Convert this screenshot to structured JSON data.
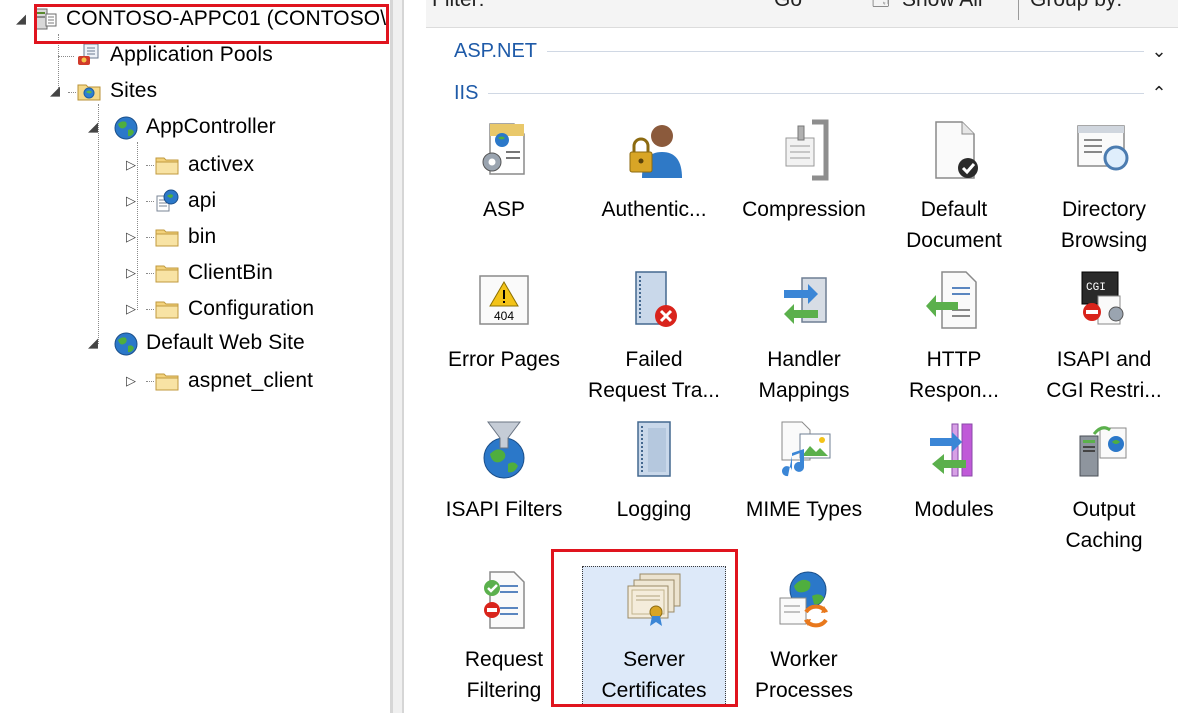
{
  "tree": {
    "nodes": [
      {
        "label": "CONTOSO-APPC01 (CONTOSO\\",
        "icon": "server-icon",
        "level": 0
      },
      {
        "label": "Application Pools",
        "icon": "app-pool-icon",
        "level": 1
      },
      {
        "label": "Sites",
        "icon": "sites-folder-icon",
        "level": 1
      },
      {
        "label": "AppController",
        "icon": "globe-icon",
        "level": 2
      },
      {
        "label": "activex",
        "icon": "folder-icon",
        "level": 3
      },
      {
        "label": "api",
        "icon": "web-app-icon",
        "level": 3
      },
      {
        "label": "bin",
        "icon": "folder-icon",
        "level": 3
      },
      {
        "label": "ClientBin",
        "icon": "folder-icon",
        "level": 3
      },
      {
        "label": "Configuration",
        "icon": "folder-icon",
        "level": 3
      },
      {
        "label": "Default Web Site",
        "icon": "globe-icon",
        "level": 2
      },
      {
        "label": "aspnet_client",
        "icon": "folder-icon",
        "level": 3
      }
    ]
  },
  "toolbar": {
    "filter_label": "Filter:",
    "go_label": "Go",
    "show_all_label": "Show All",
    "group_by_label": "Group by:"
  },
  "groups": {
    "aspnet": {
      "name": "ASP.NET",
      "chevron": "⌄"
    },
    "iis": {
      "name": "IIS",
      "chevron": "⌃"
    }
  },
  "features": [
    {
      "label": "ASP",
      "icon": "asp-icon"
    },
    {
      "label": "Authentic...",
      "icon": "authentication-icon"
    },
    {
      "label": "Compression",
      "icon": "compression-icon"
    },
    {
      "label": "Default\nDocument",
      "icon": "default-document-icon"
    },
    {
      "label": "Directory\nBrowsing",
      "icon": "directory-browsing-icon"
    },
    {
      "label": "Error Pages",
      "icon": "error-pages-icon"
    },
    {
      "label": "Failed\nRequest Tra...",
      "icon": "failed-request-tracing-icon"
    },
    {
      "label": "Handler\nMappings",
      "icon": "handler-mappings-icon"
    },
    {
      "label": "HTTP\nRespon...",
      "icon": "http-response-headers-icon"
    },
    {
      "label": "ISAPI and\nCGI Restri...",
      "icon": "isapi-cgi-restrictions-icon"
    },
    {
      "label": "ISAPI Filters",
      "icon": "isapi-filters-icon"
    },
    {
      "label": "Logging",
      "icon": "logging-icon"
    },
    {
      "label": "MIME Types",
      "icon": "mime-types-icon"
    },
    {
      "label": "Modules",
      "icon": "modules-icon"
    },
    {
      "label": "Output\nCaching",
      "icon": "output-caching-icon"
    },
    {
      "label": "Request\nFiltering",
      "icon": "request-filtering-icon"
    },
    {
      "label": "Server\nCertificates",
      "icon": "server-certificates-icon"
    },
    {
      "label": "Worker\nProcesses",
      "icon": "worker-processes-icon"
    }
  ],
  "colors": {
    "group_header": "#1e5aa8",
    "highlight_box": "#e0141e",
    "selection_fill": "#dde9f9"
  }
}
